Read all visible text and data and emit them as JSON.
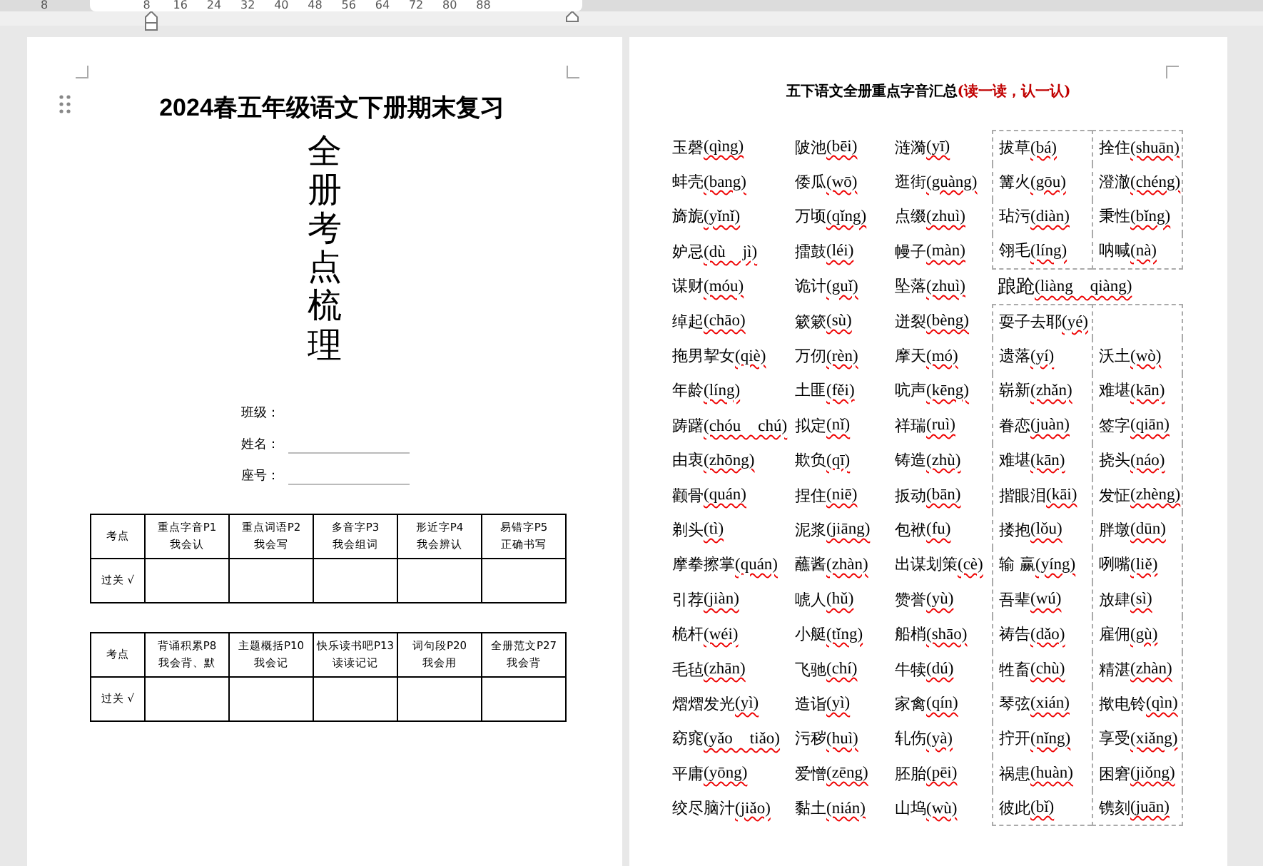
{
  "ruler": {
    "labels": [
      "8",
      "8",
      "16",
      "24",
      "32",
      "40",
      "48",
      "56",
      "64",
      "72",
      "80",
      "88"
    ]
  },
  "cover_page": {
    "title": "2024春五年级语文下册期末复习",
    "vertical_title": "全册考点梳理",
    "fields": [
      {
        "label": "班级：",
        "line": false
      },
      {
        "label": "姓名：",
        "line": true
      },
      {
        "label": "座号：",
        "line": true
      }
    ],
    "tables": [
      {
        "header": [
          [
            "考点"
          ],
          [
            "重点字音P1",
            "我会认"
          ],
          [
            "重点词语P2",
            "我会写"
          ],
          [
            "多音字P3",
            "我会组词"
          ],
          [
            "形近字P4",
            "我会辨认"
          ],
          [
            "易错字P5",
            "正确书写"
          ]
        ],
        "row_label": "过关 √"
      },
      {
        "header": [
          [
            "考点"
          ],
          [
            "背诵积累P8",
            "我会背、默"
          ],
          [
            "主题概括P10",
            "我会记"
          ],
          [
            "快乐读书吧P13",
            "读读记记"
          ],
          [
            "词句段P20",
            "我会用"
          ],
          [
            "全册范文P27",
            "我会背"
          ]
        ],
        "row_label": "过关 √"
      }
    ]
  },
  "phonetic_page": {
    "title": "五下语文全册重点字音汇总",
    "title_note": "(读一读，认一认)",
    "rows": [
      {
        "boxed": true,
        "items": [
          {
            "word": "玉磬",
            "pinyin": "(qìng)"
          },
          {
            "word": "陂池",
            "pinyin": "(bēi)"
          },
          {
            "word": "涟漪",
            "pinyin": "(yī)"
          },
          {
            "word": "拔草",
            "pinyin": "(bá)"
          },
          {
            "word": "拴住",
            "pinyin": "(shuān)"
          }
        ]
      },
      {
        "boxed": true,
        "items": [
          {
            "word": "蚌壳",
            "pinyin": "(bang)"
          },
          {
            "word": "倭瓜",
            "pinyin": "(wō)"
          },
          {
            "word": "逛街",
            "pinyin": "(guàng)"
          },
          {
            "word": "篝火",
            "pinyin": "(gōu)"
          },
          {
            "word": "澄澈",
            "pinyin": "(chéng)"
          }
        ]
      },
      {
        "boxed": true,
        "items": [
          {
            "word": "旖旎",
            "pinyin": "(yǐnǐ)"
          },
          {
            "word": "万顷",
            "pinyin": "(qǐng)"
          },
          {
            "word": "点缀",
            "pinyin": "(zhuì)"
          },
          {
            "word": "玷污",
            "pinyin": "(diàn)"
          },
          {
            "word": "秉性",
            "pinyin": "(bǐng)"
          }
        ]
      },
      {
        "boxed": true,
        "items": [
          {
            "word": "妒忌",
            "pinyin": "(dù　jì)"
          },
          {
            "word": "擂鼓",
            "pinyin": "(léi)"
          },
          {
            "word": "幔子",
            "pinyin": "(màn)"
          },
          {
            "word": "翎毛",
            "pinyin": "(líng)"
          },
          {
            "word": "呐喊",
            "pinyin": "(nà)"
          }
        ]
      },
      {
        "boxed": false,
        "items": [
          {
            "word": "谋财",
            "pinyin": "(móu)"
          },
          {
            "word": "诡计",
            "pinyin": "(guǐ)"
          },
          {
            "word": "坠落",
            "pinyin": "(zhuì)"
          },
          {
            "word": "踉跄",
            "pinyin": "(liàng　qiàng)"
          }
        ]
      },
      {
        "boxed": true,
        "items": [
          {
            "word": "绰起",
            "pinyin": "(chāo)"
          },
          {
            "word": "簌簌",
            "pinyin": "(sù)"
          },
          {
            "word": "迸裂",
            "pinyin": "(bèng)"
          },
          {
            "word": "耍子去耶",
            "pinyin": "(yé)"
          }
        ]
      },
      {
        "boxed": true,
        "items": [
          {
            "word": "拖男挈女",
            "pinyin": "(qiè)"
          },
          {
            "word": "万仞",
            "pinyin": "(rèn)"
          },
          {
            "word": "摩天",
            "pinyin": "(mó)"
          },
          {
            "word": "遗落",
            "pinyin": "(yí)"
          },
          {
            "word": "沃土",
            "pinyin": "(wò)"
          }
        ]
      },
      {
        "boxed": true,
        "items": [
          {
            "word": "年龄",
            "pinyin": "(líng)"
          },
          {
            "word": "土匪",
            "pinyin": "(fěi)"
          },
          {
            "word": "吭声",
            "pinyin": "(kēng)"
          },
          {
            "word": "崭新",
            "pinyin": "(zhǎn)"
          },
          {
            "word": "难堪",
            "pinyin": "(kān)"
          }
        ]
      },
      {
        "boxed": true,
        "items": [
          {
            "word": "踌躇",
            "pinyin": "(chóu　chú)"
          },
          {
            "word": "拟定",
            "pinyin": "(nǐ)"
          },
          {
            "word": "祥瑞",
            "pinyin": "(ruì)"
          },
          {
            "word": "眷恋",
            "pinyin": "(juàn)"
          },
          {
            "word": "签字",
            "pinyin": "(qiān)"
          }
        ]
      },
      {
        "boxed": true,
        "items": [
          {
            "word": "由衷",
            "pinyin": "(zhōng)"
          },
          {
            "word": "欺负",
            "pinyin": "(qī)"
          },
          {
            "word": "铸造",
            "pinyin": "(zhù)"
          },
          {
            "word": "难堪",
            "pinyin": "(kān)"
          },
          {
            "word": "挠头",
            "pinyin": "(náo)"
          }
        ]
      },
      {
        "boxed": true,
        "items": [
          {
            "word": "颧骨",
            "pinyin": "(quán)"
          },
          {
            "word": "捏住",
            "pinyin": "(niē)"
          },
          {
            "word": "扳动",
            "pinyin": "(bān)"
          },
          {
            "word": "揩眼泪",
            "pinyin": "(kāi)"
          },
          {
            "word": "发怔",
            "pinyin": "(zhèng)"
          }
        ]
      },
      {
        "boxed": true,
        "items": [
          {
            "word": "剃头",
            "pinyin": "(tì)"
          },
          {
            "word": "泥浆",
            "pinyin": "(jiāng)"
          },
          {
            "word": "包袱",
            "pinyin": "(fu)"
          },
          {
            "word": "搂抱",
            "pinyin": "(lǒu)"
          },
          {
            "word": "胖墩",
            "pinyin": "(dūn)"
          }
        ]
      },
      {
        "boxed": true,
        "items": [
          {
            "word": "摩拳擦掌",
            "pinyin": "(quán)"
          },
          {
            "word": "蘸酱",
            "pinyin": "(zhàn)"
          },
          {
            "word": "出谋划策",
            "pinyin": "(cè)"
          },
          {
            "word": "输 赢",
            "pinyin": "(yíng)"
          },
          {
            "word": "咧嘴",
            "pinyin": "(liě)"
          }
        ]
      },
      {
        "boxed": true,
        "items": [
          {
            "word": "引荐",
            "pinyin": "(jiàn)"
          },
          {
            "word": "唬人",
            "pinyin": "(hǔ)"
          },
          {
            "word": "赞誉",
            "pinyin": "(yù)"
          },
          {
            "word": "吾辈",
            "pinyin": "(wú)"
          },
          {
            "word": "放肆",
            "pinyin": "(sì)"
          }
        ]
      },
      {
        "boxed": true,
        "items": [
          {
            "word": "桅杆",
            "pinyin": "(wéi)"
          },
          {
            "word": "小艇",
            "pinyin": "(tǐng)"
          },
          {
            "word": "船梢",
            "pinyin": "(shāo)"
          },
          {
            "word": "祷告",
            "pinyin": "(dǎo)"
          },
          {
            "word": "雇佣",
            "pinyin": "(gù)"
          }
        ]
      },
      {
        "boxed": true,
        "items": [
          {
            "word": "毛毡",
            "pinyin": "(zhān)"
          },
          {
            "word": "飞驰",
            "pinyin": "(chí)"
          },
          {
            "word": "牛犊",
            "pinyin": "(dú)"
          },
          {
            "word": "牲畜",
            "pinyin": "(chù)"
          },
          {
            "word": "精湛",
            "pinyin": "(zhàn)"
          }
        ]
      },
      {
        "boxed": true,
        "items": [
          {
            "word": "熠熠发光",
            "pinyin": "(yì)"
          },
          {
            "word": "造诣",
            "pinyin": "(yì)"
          },
          {
            "word": "家禽",
            "pinyin": "(qín)"
          },
          {
            "word": "琴弦",
            "pinyin": "(xián)"
          },
          {
            "word": "揿电铃",
            "pinyin": "(qìn)"
          }
        ]
      },
      {
        "boxed": true,
        "items": [
          {
            "word": "窈窕",
            "pinyin": "(yǎo　tiǎo)"
          },
          {
            "word": "污秽",
            "pinyin": "(huì)"
          },
          {
            "word": "轧伤",
            "pinyin": "(yà)"
          },
          {
            "word": "拧开",
            "pinyin": "(nǐng)"
          },
          {
            "word": "享受",
            "pinyin": "(xiǎng)"
          }
        ]
      },
      {
        "boxed": true,
        "items": [
          {
            "word": "平庸",
            "pinyin": "(yōng)"
          },
          {
            "word": "爱憎",
            "pinyin": "(zēng)"
          },
          {
            "word": "胚胎",
            "pinyin": "(pēi)"
          },
          {
            "word": "祸患",
            "pinyin": "(huàn)"
          },
          {
            "word": "困窘",
            "pinyin": "(jiǒng)"
          }
        ]
      },
      {
        "boxed": true,
        "items": [
          {
            "word": "绞尽脑汁",
            "pinyin": "(jiǎo)"
          },
          {
            "word": "黏土",
            "pinyin": "(nián)"
          },
          {
            "word": "山坞",
            "pinyin": "(wù)"
          },
          {
            "word": "彼此",
            "pinyin": "(bǐ)"
          },
          {
            "word": "镌刻",
            "pinyin": "(juān)"
          }
        ]
      }
    ]
  }
}
